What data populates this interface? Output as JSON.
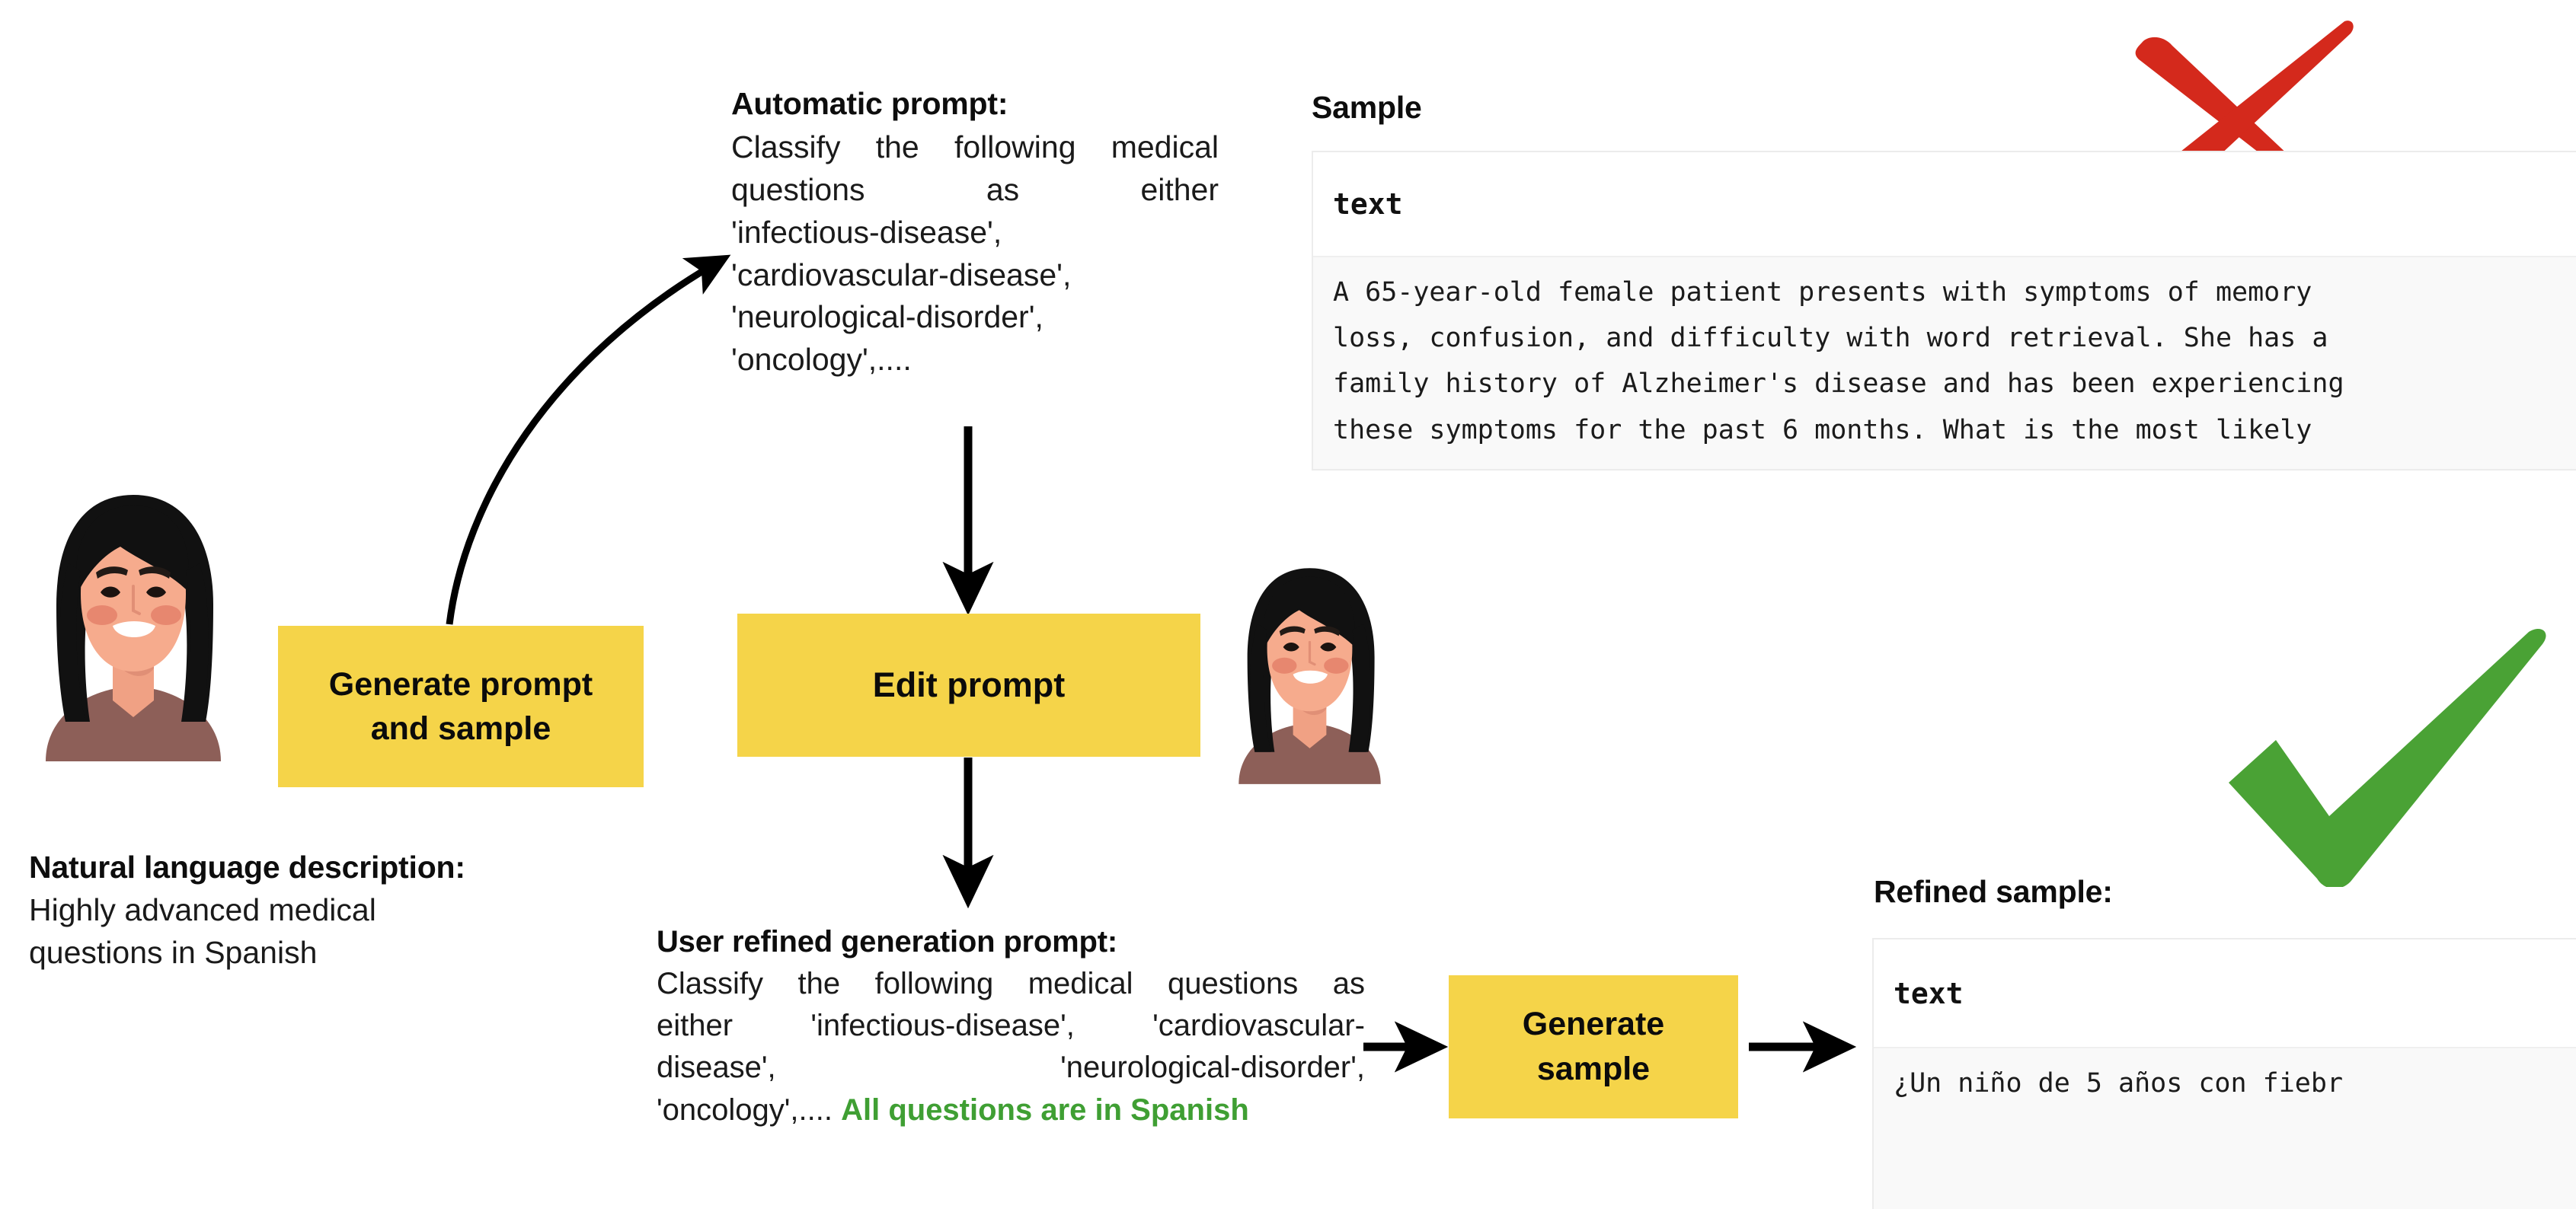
{
  "diagram": {
    "title_hidden": "Prompt and sample refinement loop",
    "colors": {
      "action_box": "#f5d449",
      "green_emphasis": "#3f9f33",
      "cross_red": "#d4291c",
      "check_green": "#4aa235",
      "frame_border": "#ececec",
      "frame_body_bg": "#f9f9f9"
    }
  },
  "automatic_prompt": {
    "heading": "Automatic prompt:",
    "line1": "Classify the following medical",
    "line2": "questions as either",
    "line3": "'infectious-disease',",
    "line4": "'cardiovascular-disease',",
    "line5": "'neurological-disorder',",
    "line6": "'oncology',...."
  },
  "natural_language_description": {
    "heading": "Natural language description:",
    "line1": "Highly advanced medical",
    "line2": "questions in Spanish"
  },
  "user_refined_prompt": {
    "heading": "User refined generation prompt:",
    "line1": "Classify the following medical questions as",
    "line2": "either 'infectious-disease', 'cardiovascular-",
    "line3": "disease', 'neurological-disorder',",
    "line4_prefix": "'oncology',....",
    "line4_emphasis": "All questions are in Spanish"
  },
  "sample": {
    "label": "Sample",
    "column_header": "text",
    "body_line1": "A 65-year-old female patient presents with symptoms of memory",
    "body_line2": "loss, confusion, and difficulty with word retrieval. She has a",
    "body_line3": "family history of Alzheimer's disease and has been experiencing",
    "body_line4": "these symptoms for the past 6 months. What is the most likely"
  },
  "refined_sample": {
    "label": "Refined sample:",
    "column_header": "text",
    "body_line1": "¿Un niño de 5 años con fiebr"
  },
  "actions": {
    "generate_prompt_and_sample": "Generate prompt\nand sample",
    "generate_prompt_and_sample_line1": "Generate prompt",
    "generate_prompt_and_sample_line2": "and sample",
    "edit_prompt": "Edit prompt",
    "generate_sample_line1": "Generate",
    "generate_sample_line2": "sample"
  },
  "verdicts": {
    "reject_icon": "red-cross-mark",
    "accept_icon": "green-check-mark"
  },
  "avatars": {
    "user_left": "user-avatar",
    "user_right": "user-avatar"
  }
}
